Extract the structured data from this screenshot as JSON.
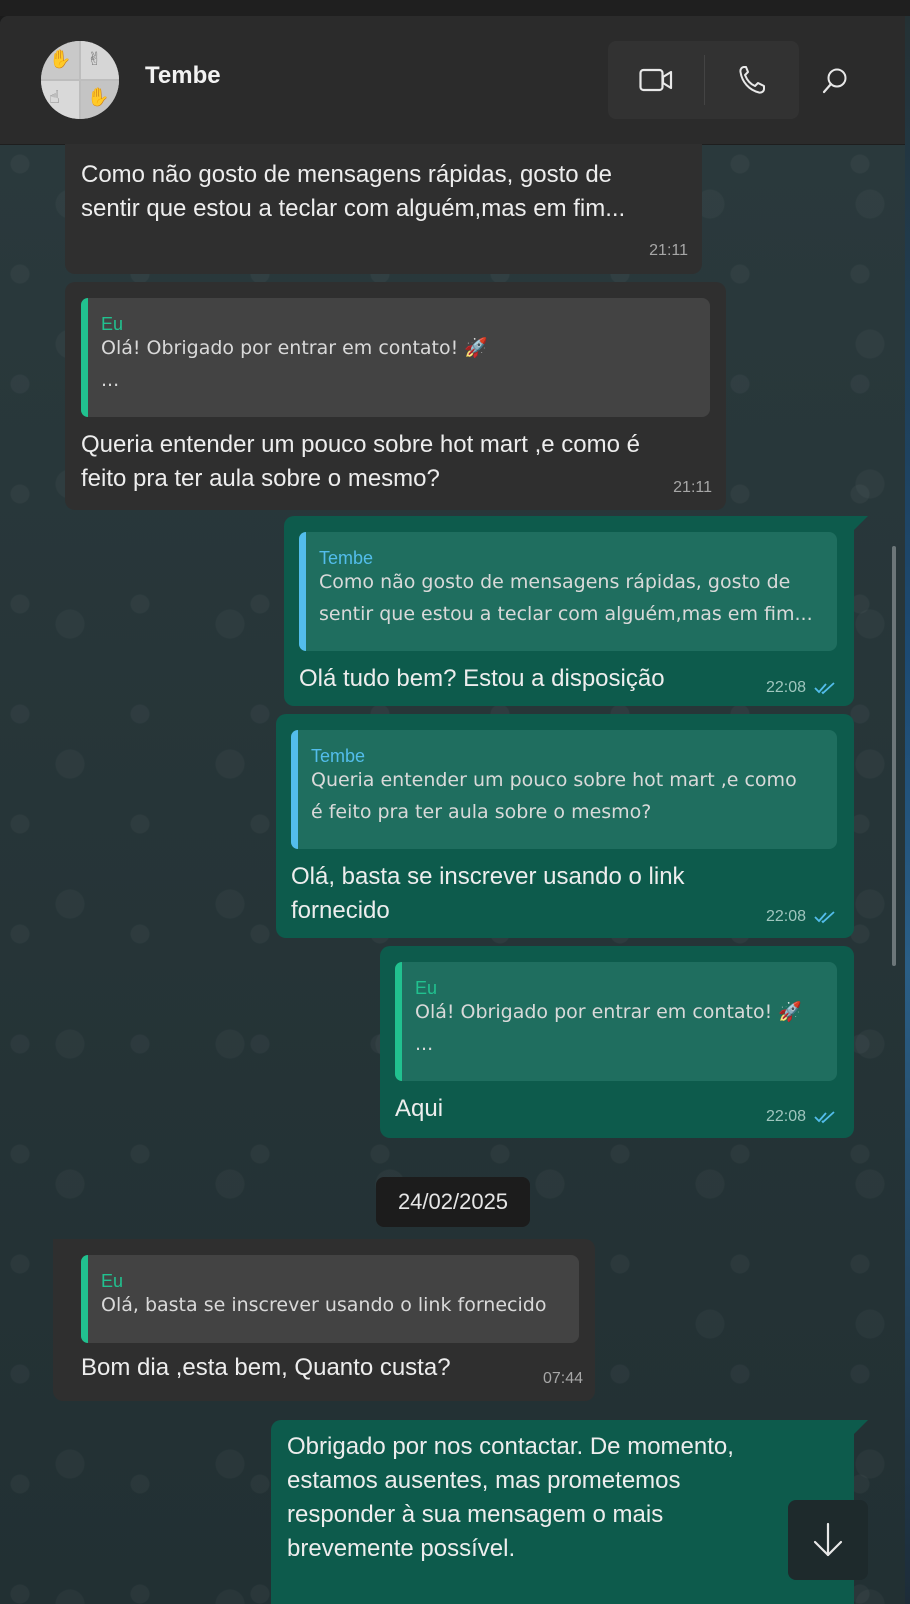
{
  "header": {
    "contact_name": "Tembe",
    "icons": [
      "avatar",
      "video-call-icon",
      "voice-call-icon",
      "search-icon"
    ]
  },
  "messages": [
    {
      "direction": "incoming",
      "lines": [
        "Como não gosto de mensagens rápidas, gosto de",
        "sentir que estou a teclar com alguém,mas em fim..."
      ],
      "time": "21:11"
    },
    {
      "direction": "incoming",
      "quote_author": "Eu",
      "quote_lines": [
        "Olá! Obrigado por entrar em contato! 🚀",
        "..."
      ],
      "lines": [
        "Queria entender um pouco sobre hot mart ,e como é",
        "feito pra ter aula sobre o mesmo?"
      ],
      "time": "21:11"
    },
    {
      "direction": "outgoing",
      "quote_author": "Tembe",
      "quote_lines": [
        "Como não gosto de mensagens rápidas, gosto de",
        "sentir que estou a teclar com alguém,mas em fim..."
      ],
      "lines": [
        "Olá tudo bem? Estou a disposição"
      ],
      "time": "22:08",
      "status": "read"
    },
    {
      "direction": "outgoing",
      "quote_author": "Tembe",
      "quote_lines": [
        "Queria entender um pouco sobre hot mart ,e como",
        "é feito pra ter aula sobre o mesmo?"
      ],
      "lines": [
        "Olá, basta se inscrever usando o link",
        "fornecido"
      ],
      "time": "22:08",
      "status": "read"
    },
    {
      "direction": "outgoing",
      "quote_author": "Eu",
      "quote_lines": [
        "Olá! Obrigado por entrar em contato! 🚀",
        "..."
      ],
      "lines": [
        "Aqui"
      ],
      "time": "22:08",
      "status": "read"
    },
    {
      "direction": "incoming",
      "quote_author": "Eu",
      "quote_lines": [
        "Olá, basta se inscrever usando o link fornecido"
      ],
      "lines": [
        "Bom dia ,esta bem, Quanto custa?"
      ],
      "time": "07:44"
    },
    {
      "direction": "outgoing",
      "lines": [
        "Obrigado por nos contactar. De momento,",
        "estamos ausentes, mas prometemos",
        "responder à sua mensagem o mais",
        "brevemente possível."
      ]
    }
  ],
  "date_separator": "24/02/2025",
  "colors": {
    "incoming_bubble": "#2f2f2f",
    "outgoing_bubble": "#0d5b4c",
    "quote_author_self": "#21c18f",
    "quote_author_contact": "#53bdeb",
    "read_ticks": "#53bdeb"
  }
}
